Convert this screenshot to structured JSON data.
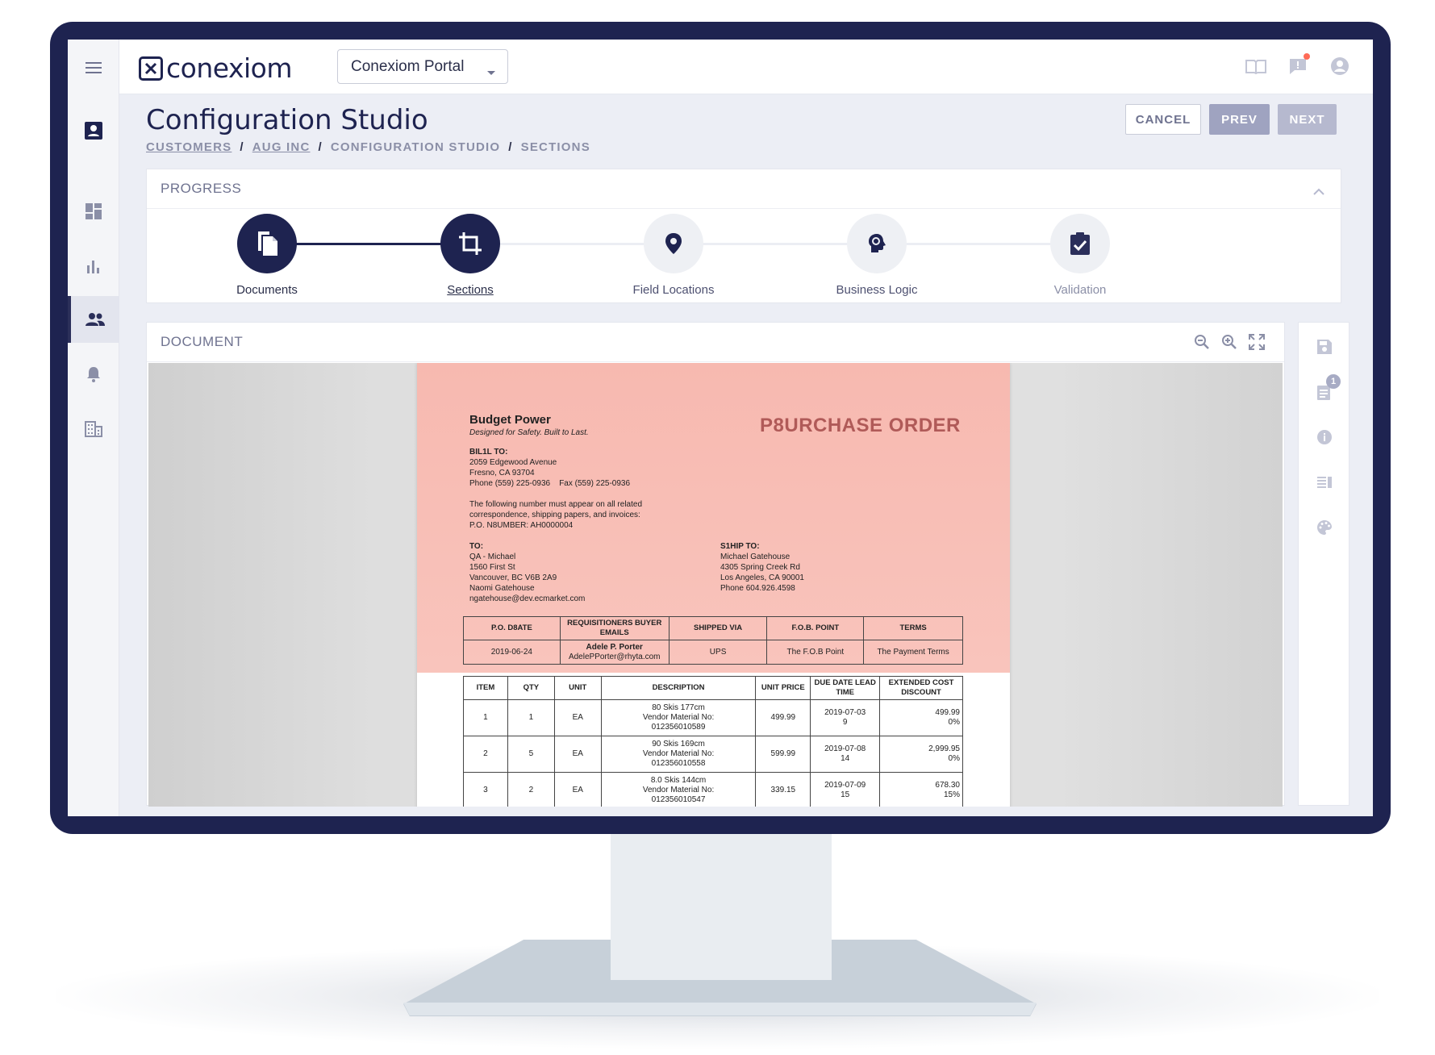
{
  "app": {
    "logo_text": "conexiom",
    "portal_select": "Conexiom Portal"
  },
  "header": {
    "title": "Configuration Studio",
    "breadcrumb": [
      "CUSTOMERS",
      "AUG INC",
      "CONFIGURATION STUDIO",
      "SECTIONS"
    ],
    "breadcrumb_sep": "/",
    "cancel_label": "CANCEL",
    "prev_label": "PREV",
    "next_label": "NEXT"
  },
  "progress": {
    "heading": "PROGRESS",
    "steps": [
      {
        "label": "Documents",
        "state": "done",
        "icon": "documents-icon"
      },
      {
        "label": "Sections",
        "state": "current",
        "icon": "crop-icon"
      },
      {
        "label": "Field Locations",
        "state": "pending",
        "icon": "location-pin-icon"
      },
      {
        "label": "Business Logic",
        "state": "pending",
        "icon": "brain-gear-icon"
      },
      {
        "label": "Validation",
        "state": "pending",
        "icon": "clipboard-check-icon"
      }
    ]
  },
  "document": {
    "heading": "DOCUMENT",
    "side_badge": "1",
    "po": {
      "company": "Budget Power",
      "tagline": "Designed for Safety. Built to Last.",
      "title": "P8URCHASE ORDER",
      "bill_to_label": "BIL1L TO:",
      "bill_to_lines": [
        "2059 Edgewood Avenue",
        "Fresno, CA 93704",
        "Phone (559) 225-0936    Fax (559) 225-0936"
      ],
      "notice_lines": [
        "The following number must appear on all related",
        "correspondence, shipping papers, and invoices:",
        "P.O. N8UMBER: AH0000004"
      ],
      "to_label": "TO:",
      "to_lines": [
        "QA - Michael",
        "1560 First St",
        "Vancouver, BC V6B 2A9",
        "Naomi Gatehouse",
        "ngatehouse@dev.ecmarket.com"
      ],
      "ship_to_label": "S1HIP TO:",
      "ship_to_lines": [
        "Michael Gatehouse",
        "4305 Spring Creek Rd",
        "Los Angeles, CA 90001",
        "Phone 604.926.4598"
      ],
      "info_headers": [
        "P.O. D8ATE",
        "REQUISITIONERS BUYER EMAILS",
        "SHIPPED VIA",
        "F.O.B. POINT",
        "TERMS"
      ],
      "info_row": {
        "date": "2019-06-24",
        "buyer_name": "Adele P. Porter",
        "buyer_email": "AdelePPorter@rhyta.com",
        "shipped_via": "UPS",
        "fob": "The F.O.B Point",
        "terms": "The Payment Terms"
      },
      "item_headers": [
        "ITEM",
        "QTY",
        "UNIT",
        "DESCRIPTION",
        "UNIT PRICE",
        "DUE DATE LEAD TIME",
        "EXTENDED COST DISCOUNT"
      ],
      "items": [
        {
          "item": "1",
          "qty": "1",
          "unit": "EA",
          "desc1": "80 Skis 177cm",
          "desc2": "Vendor Material No:",
          "desc3": "012356010589",
          "price": "499.99",
          "due": "2019-07-03",
          "lead": "9",
          "cost": "499.99",
          "discount": "0%"
        },
        {
          "item": "2",
          "qty": "5",
          "unit": "EA",
          "desc1": "90 Skis 169cm",
          "desc2": "Vendor Material No:",
          "desc3": "012356010558",
          "price": "599.99",
          "due": "2019-07-08",
          "lead": "14",
          "cost": "2,999.95",
          "discount": "0%"
        },
        {
          "item": "3",
          "qty": "2",
          "unit": "EA",
          "desc1": "8.0 Skis 144cm",
          "desc2": "Vendor Material No:",
          "desc3": "012356010547",
          "price": "339.15",
          "due": "2019-07-09",
          "lead": "15",
          "cost": "678.30",
          "discount": "15%"
        }
      ]
    }
  },
  "colors": {
    "navy": "#1e2350",
    "highlight": "#f7b9b0",
    "title_red": "#b05a58"
  }
}
